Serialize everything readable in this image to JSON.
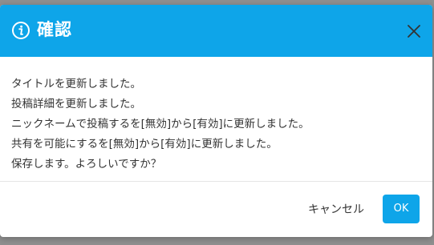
{
  "dialog": {
    "title": "確認",
    "icon": "info-circle-icon",
    "close_icon": "close-icon",
    "messages": [
      "タイトルを更新しました。",
      "投稿詳細を更新しました。",
      "ニックネームで投稿するを[無効]から[有効]に更新しました。",
      "共有を可能にするを[無効]から[有効]に更新しました。",
      "保存します。よろしいですか？"
    ],
    "cancel_label": "キャンセル",
    "ok_label": "OK"
  },
  "colors": {
    "accent": "#0ea5e9",
    "text": "#333333",
    "backdrop": "#8f8f8f"
  }
}
